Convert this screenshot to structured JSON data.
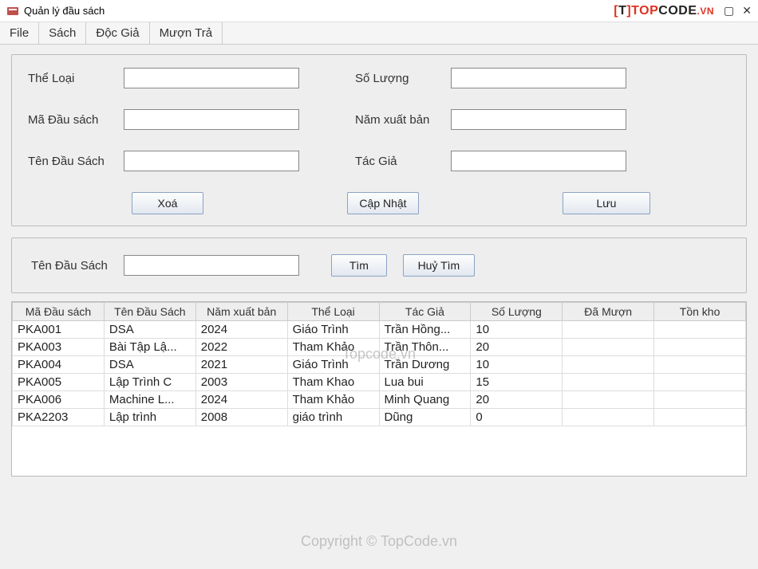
{
  "window": {
    "title": "Quản lý đầu sách"
  },
  "brand": {
    "bracket_open": "[",
    "t": "T",
    "bracket_close": "]",
    "top": "TOP",
    "code": "CODE",
    "vn": ".VN"
  },
  "menubar": [
    "File",
    "Sách",
    "Độc Giả",
    "Mượn Trả"
  ],
  "form": {
    "labels": {
      "the_loai": "Thể Loại",
      "ma_dau_sach": "Mã Đầu sách",
      "ten_dau_sach": "Tên Đầu Sách",
      "so_luong": "Số Lượng",
      "nam_xuat_ban": "Năm xuất bản",
      "tac_gia": "Tác Giả"
    },
    "values": {
      "the_loai": "",
      "ma_dau_sach": "",
      "ten_dau_sach": "",
      "so_luong": "",
      "nam_xuat_ban": "",
      "tac_gia": ""
    },
    "buttons": {
      "xoa": "Xoá",
      "cap_nhat": "Cập Nhật",
      "luu": "Lưu"
    }
  },
  "search": {
    "label": "Tên Đầu Sách",
    "value": "",
    "buttons": {
      "tim": "Tìm",
      "huy_tim": "Huỷ Tìm"
    }
  },
  "table": {
    "columns": [
      "Mã Đầu sách",
      "Tên Đầu Sách",
      "Năm xuất bản",
      "Thể Loại",
      "Tác Giả",
      "Số Lượng",
      "Đã Mượn",
      "Tồn kho"
    ],
    "rows": [
      [
        "PKA001",
        "DSA",
        "2024",
        "Giáo Trình",
        "Trần Hồng...",
        "10",
        "",
        ""
      ],
      [
        "PKA003",
        "Bài Tập Lậ...",
        "2022",
        "Tham Khảo",
        "Trần Thôn...",
        "20",
        "",
        ""
      ],
      [
        "PKA004",
        "DSA",
        "2021",
        "Giáo Trình",
        "Trần Dương",
        "10",
        "",
        ""
      ],
      [
        "PKA005",
        "Lập Trình C",
        "2003",
        "Tham Khao",
        "Lua bui",
        "15",
        "",
        ""
      ],
      [
        "PKA006",
        "Machine L...",
        "2024",
        "Tham Khảo",
        "Minh Quang",
        "20",
        "",
        ""
      ],
      [
        "PKA2203",
        "Lập trình",
        "2008",
        "giáo trình",
        "Dũng",
        "0",
        "",
        ""
      ]
    ]
  },
  "watermarks": {
    "wm1": "Topcode.vn",
    "wm2": "Copyright © TopCode.vn"
  }
}
